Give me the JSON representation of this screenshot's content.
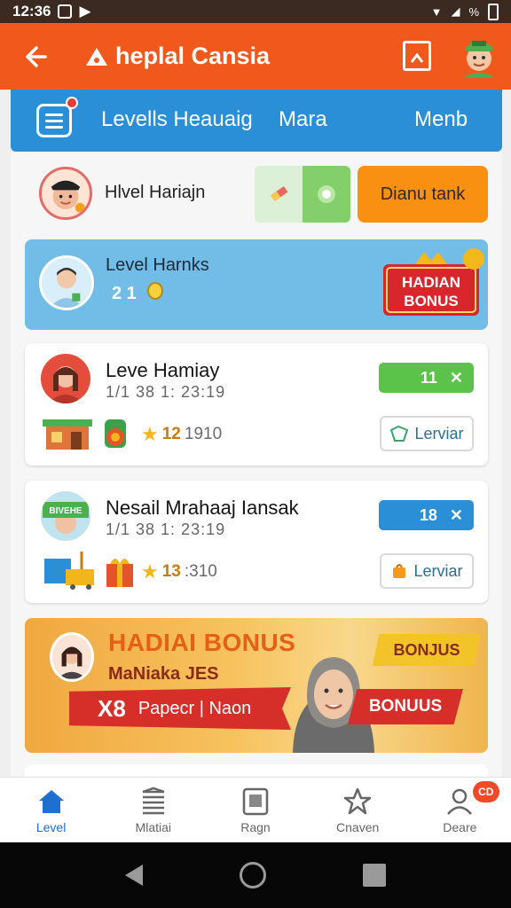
{
  "status_bar": {
    "time": "12:36",
    "battery_text": "%"
  },
  "app_bar": {
    "title": "heplal Cansia"
  },
  "tabs": [
    {
      "label": "Levells Heauaig"
    },
    {
      "label": "Mara"
    },
    {
      "label": "Menb"
    }
  ],
  "row1": {
    "name": "Hlvel Hariajn",
    "action_label": "Dianu tank"
  },
  "featured": {
    "title": "Level Harnks",
    "number": "2 1",
    "badge_line1": "HADIAN",
    "badge_line2": "BONUS"
  },
  "cards": [
    {
      "title": "Leve Hamiay",
      "date": "1/1 38 1: 23:19",
      "points": "12",
      "total": "1910",
      "pill": "11",
      "action": "Lerviar"
    },
    {
      "title": "Nesail Mrahaaj Iansak",
      "date": "1/1 38 1: 23:19",
      "points": "13",
      "total": ":310",
      "pill": "18",
      "action": "Lerviar",
      "avatar_text": "BIVEHE"
    }
  ],
  "promo": {
    "title": "HADIAI BONUS",
    "subtitle": "MaNiaka JES",
    "ribbon_x": "X8",
    "ribbon_text": "Papecr | Naon",
    "tag_top": "BONJUS",
    "tag_bottom": "BONUUS"
  },
  "bottom_nav": [
    {
      "label": "Level"
    },
    {
      "label": "Mlatiai"
    },
    {
      "label": "Ragn"
    },
    {
      "label": "Cnaven"
    },
    {
      "label": "Deare",
      "badge": "CD"
    }
  ],
  "colors": {
    "brand_orange": "#f0581c",
    "tab_blue": "#2a8fd6",
    "accent_green": "#5cc34a",
    "action_orange": "#f99012"
  }
}
